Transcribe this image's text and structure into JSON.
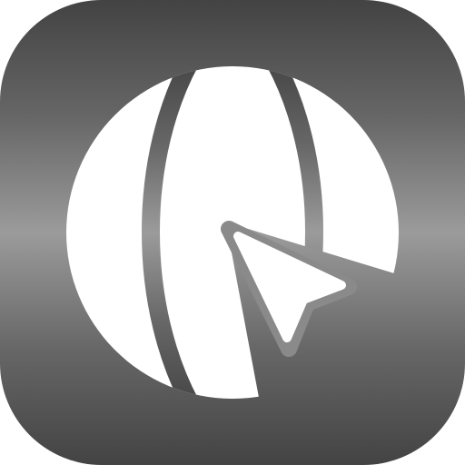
{
  "app_icon": {
    "icon": "globe-cursor-icon",
    "background_gradient": [
      "#434343",
      "#666666",
      "#9b9b9b",
      "#676767",
      "#434343"
    ],
    "glyph_color": "#ffffff",
    "gap_color": "#808080"
  }
}
